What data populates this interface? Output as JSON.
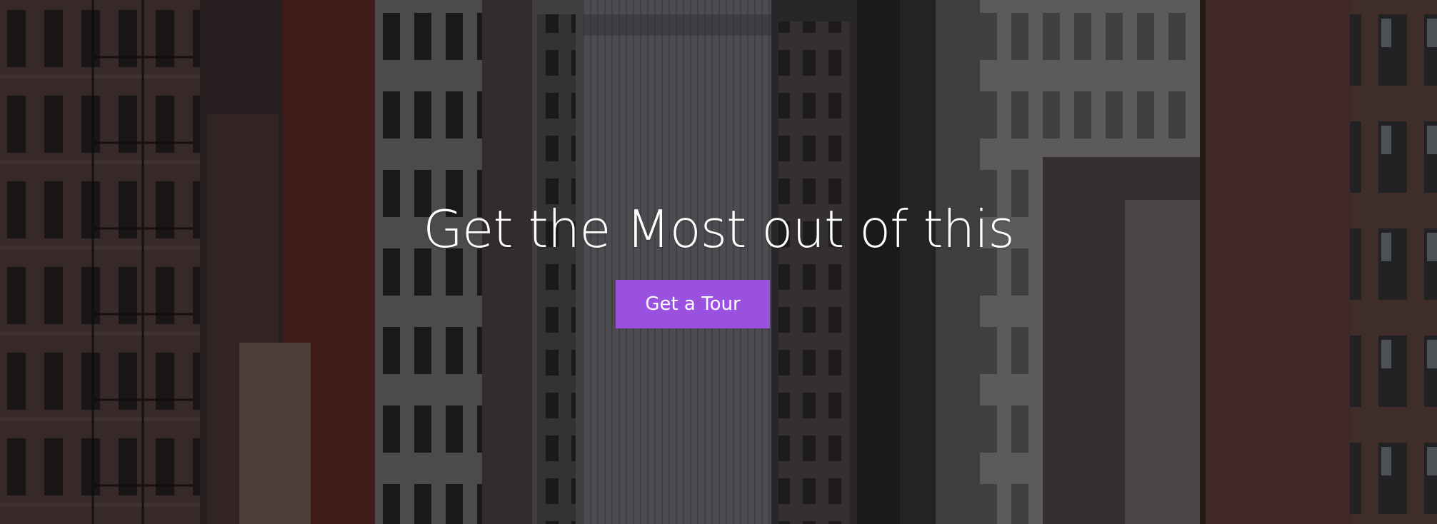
{
  "hero": {
    "title": "Get the Most out of this",
    "cta_label": "Get a Tour",
    "background_image": "city-street-buildings-photo"
  },
  "colors": {
    "cta_background": "#9b51e0",
    "text": "#ffffff"
  }
}
